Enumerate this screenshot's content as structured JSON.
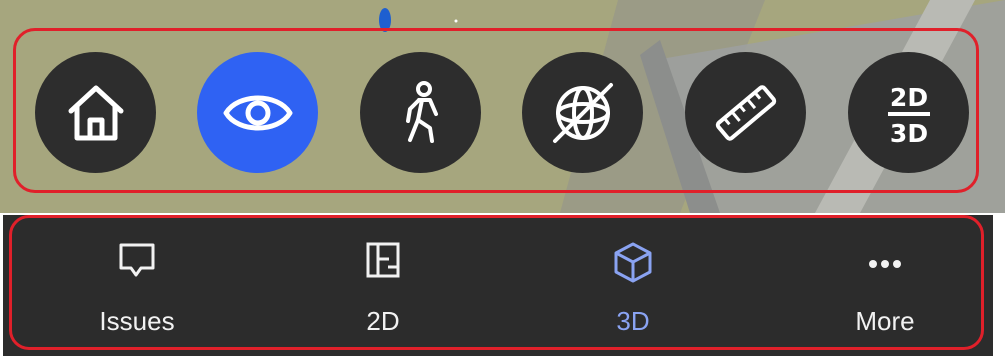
{
  "toolbar": {
    "buttons": [
      {
        "id": "home",
        "icon": "home-icon",
        "active": false
      },
      {
        "id": "look",
        "icon": "eye-icon",
        "active": true
      },
      {
        "id": "walk",
        "icon": "walking-person-icon",
        "active": false
      },
      {
        "id": "orbit",
        "icon": "orbit-icon",
        "active": false
      },
      {
        "id": "measure",
        "icon": "ruler-icon",
        "active": false
      },
      {
        "id": "view-toggle",
        "icon": "2d-3d-toggle-icon",
        "active": false
      }
    ],
    "toggle_top": "2D",
    "toggle_bottom": "3D",
    "active_color": "#2f62f3",
    "button_color": "#2d2d2d"
  },
  "nav": {
    "items": [
      {
        "label": "Issues",
        "icon": "chat-bubble-icon",
        "selected": false
      },
      {
        "label": "2D",
        "icon": "floorplan-icon",
        "selected": false
      },
      {
        "label": "3D",
        "icon": "cube-icon",
        "selected": true
      },
      {
        "label": "More",
        "icon": "more-dots-icon",
        "selected": false
      }
    ],
    "selected_color": "#8aa3f2",
    "background": "#2c2c2c"
  },
  "annotation_color": "#e0202a"
}
